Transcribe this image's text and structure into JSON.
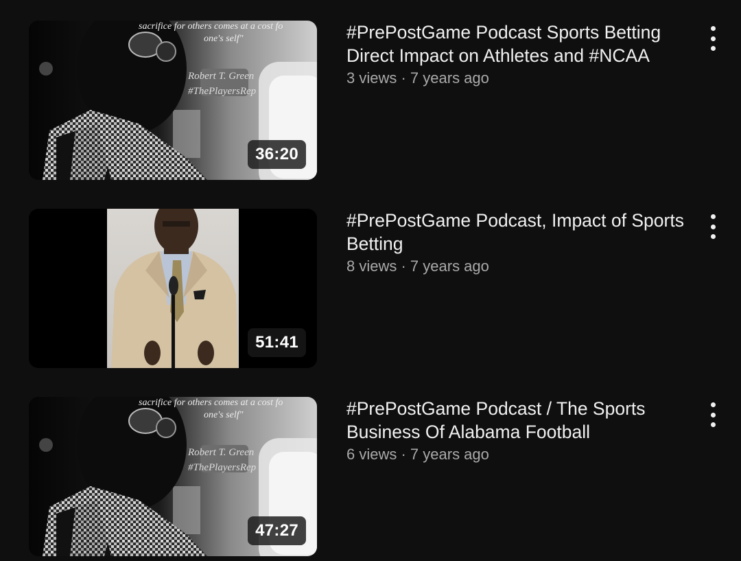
{
  "videos": [
    {
      "title": "#PrePostGame Podcast Sports Betting Direct Impact on Athletes and #NCAA",
      "views": "3 views",
      "age": "7 years ago",
      "duration": "36:20",
      "thumb_text": {
        "quote_line1": "sacrifice for others comes at a cost fo",
        "quote_line2": "one's self\"",
        "name": "Robert T. Green",
        "handle": "#ThePlayersRep"
      }
    },
    {
      "title": "#PrePostGame Podcast, Impact of Sports Betting",
      "views": "8 views",
      "age": "7 years ago",
      "duration": "51:41"
    },
    {
      "title": "#PrePostGame Podcast / The Sports Business Of Alabama Football",
      "views": "6 views",
      "age": "7 years ago",
      "duration": "47:27",
      "thumb_text": {
        "quote_line1": "sacrifice for others comes at a cost fo",
        "quote_line2": "one's self\"",
        "name": "Robert T. Green",
        "handle": "#ThePlayersRep"
      }
    }
  ],
  "separator": " · ",
  "icons": {
    "more": "more-vert-icon"
  }
}
